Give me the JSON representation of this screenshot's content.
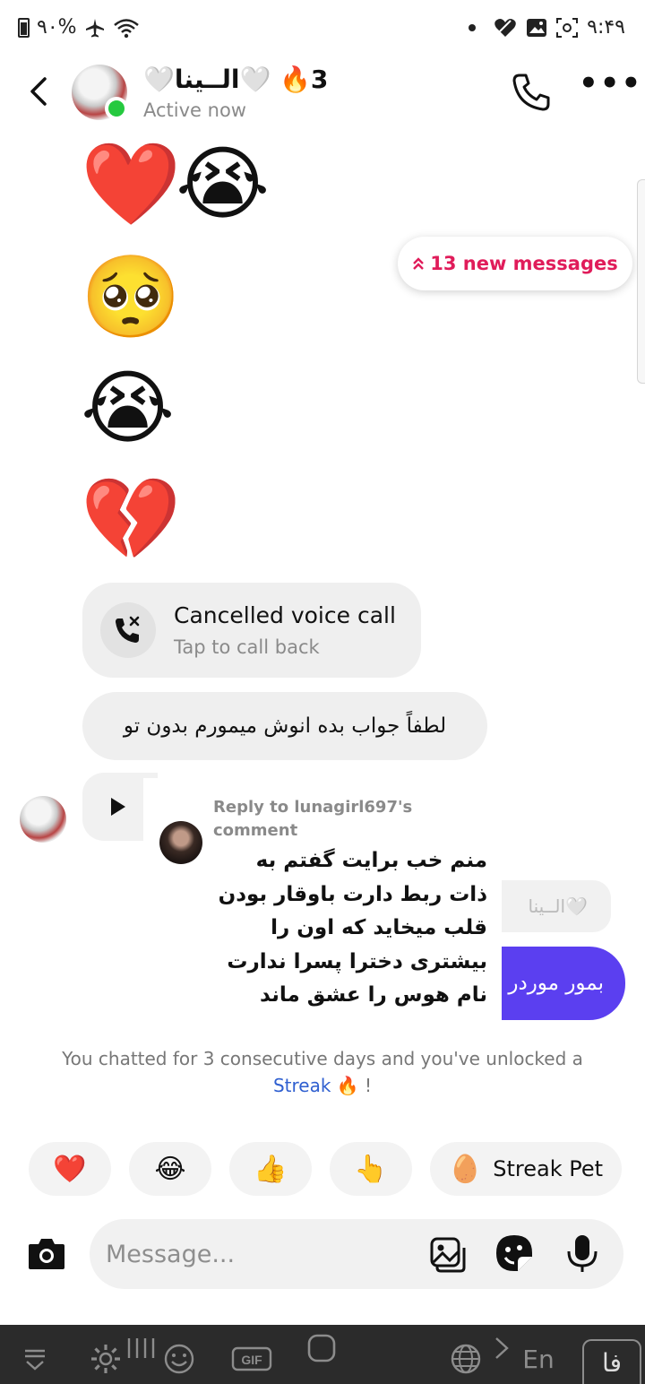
{
  "status_bar": {
    "battery": "۹۰%",
    "time": "۹:۴۹"
  },
  "header": {
    "contact_name": "🤍الــینا🤍",
    "streak": "🔥3",
    "presence": "Active now"
  },
  "messages": {
    "emoji_row_1": [
      "❤️",
      "😭"
    ],
    "emoji_2": "🥺",
    "emoji_3": "😭",
    "emoji_4": "💔",
    "new_messages_banner": "13 new messages",
    "call": {
      "title": "Cancelled voice call",
      "subtitle": "Tap to call back"
    },
    "text_1": "لطفاً جواب بده انوش میمورم بدون تو",
    "reply": {
      "label": "Reply to lunagirl697's comment",
      "text": "منم خب برایت گفتم به ذات ربط دارت باوقار بودن قلب میخاید که اون را بیشتری دخترا پسرا ندارت نام هوس را عشق ماند"
    },
    "partial_bubble": "الــینا🤍",
    "partial_purple": "بمور موردر"
  },
  "streak_note": {
    "text": "You chatted for 3 consecutive days and you've unlocked a",
    "link": "Streak",
    "suffix": "🔥 !"
  },
  "quick_replies": [
    "❤️",
    "😂",
    "👍",
    "👆"
  ],
  "streak_pet": {
    "emoji": "🥚",
    "label": "Streak Pet"
  },
  "composer": {
    "placeholder": "Message..."
  },
  "keyboard": {
    "lang_en": "En",
    "lang_fa": "فا"
  },
  "colors": {
    "accent_pink": "#e01c5a",
    "sent_bubble": "#5b3ff0",
    "online": "#25c93f",
    "link_blue": "#2f5fd0"
  }
}
